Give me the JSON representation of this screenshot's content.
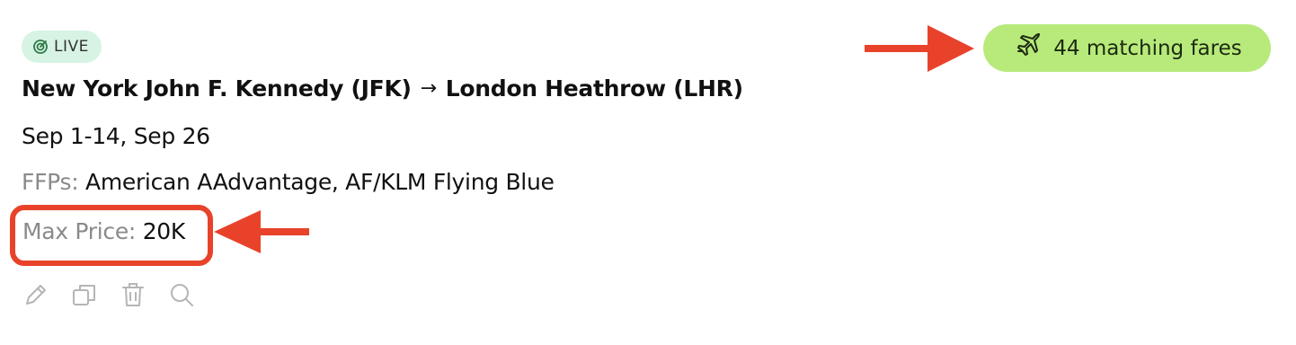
{
  "status_badge": {
    "label": "LIVE",
    "icon": "target-icon",
    "color": "#d7f3e3"
  },
  "route": {
    "origin": "New York John F. Kennedy (JFK)",
    "separator": "→",
    "destination": "London Heathrow (LHR)"
  },
  "dates": "Sep 1-14, Sep 26",
  "ffps": {
    "label": "FFPs:",
    "value": "American AAdvantage, AF/KLM Flying Blue"
  },
  "max_price": {
    "label": "Max Price:",
    "value": "20K"
  },
  "actions": [
    {
      "icon": "pencil-icon"
    },
    {
      "icon": "copy-icon"
    },
    {
      "icon": "trash-icon"
    },
    {
      "icon": "search-icon"
    }
  ],
  "fares": {
    "label": "44 matching fares",
    "icon": "airplane-icon",
    "color": "#b8ea7b"
  },
  "annotations": {
    "color": "#e8432a"
  }
}
